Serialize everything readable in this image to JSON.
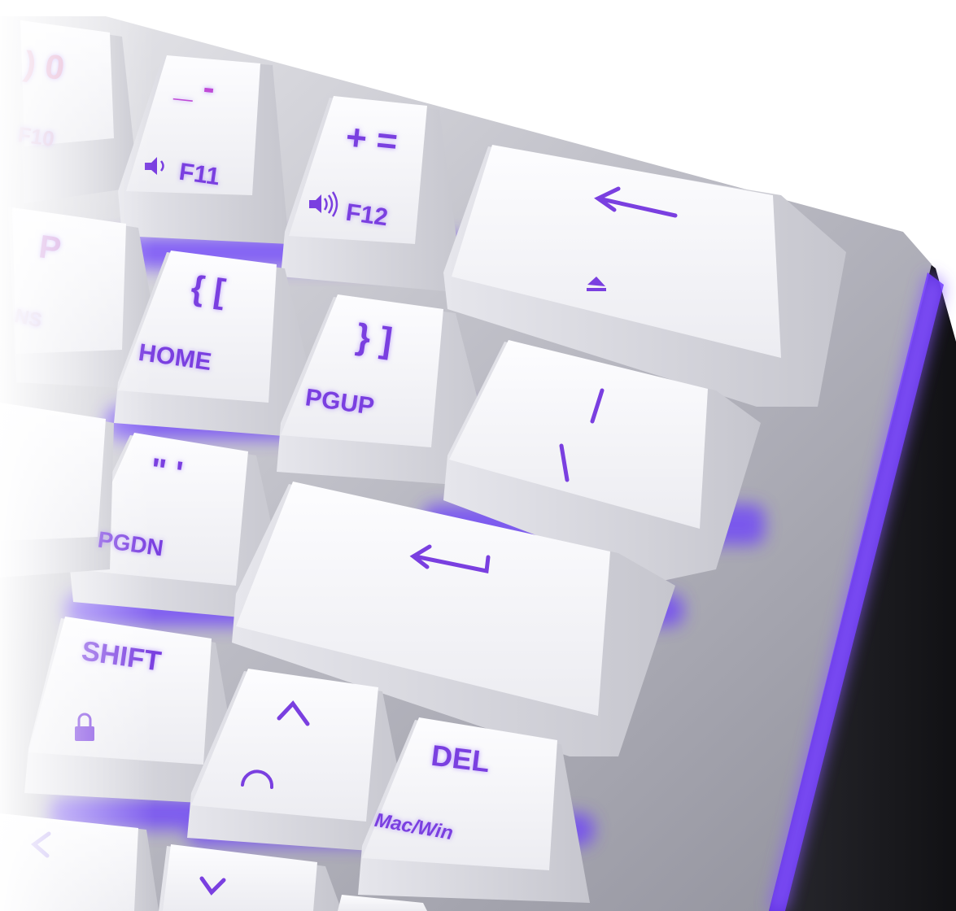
{
  "keycaps": {
    "k0": {
      "main": "0",
      "primary": ") 0",
      "secondary": "F10"
    },
    "minus": {
      "primary": "_ -",
      "secondary": "F11"
    },
    "equals": {
      "primary": "+ =",
      "secondary": "F12"
    },
    "p": {
      "primary": "P",
      "secondary": "NS"
    },
    "lbracket": {
      "primary": "{ [",
      "secondary": "HOME"
    },
    "rbracket": {
      "primary": "} ]",
      "secondary": "PGUP"
    },
    "backslash": {
      "primary": "/",
      "secondary": "\\"
    },
    "quote": {
      "primary": "\" '",
      "secondary": "PGDN"
    },
    "shift": {
      "primary": "SHIFT"
    },
    "del": {
      "primary": "DEL",
      "secondary": "Mac/Win"
    }
  },
  "colors": {
    "backlight": "#6a32ff",
    "legend": "#7a3fe0",
    "keycap": "#f4f4f6",
    "frame_dark": "#1c1c20",
    "frame_metal": "#c9c9cf"
  },
  "icons": [
    "volume-down-icon",
    "volume-up-icon",
    "backspace-arrow-icon",
    "eject-icon",
    "enter-arrow-icon",
    "lock-icon",
    "up-arrow-icon",
    "speedometer-icon",
    "left-arrow-icon",
    "down-arrow-icon"
  ]
}
